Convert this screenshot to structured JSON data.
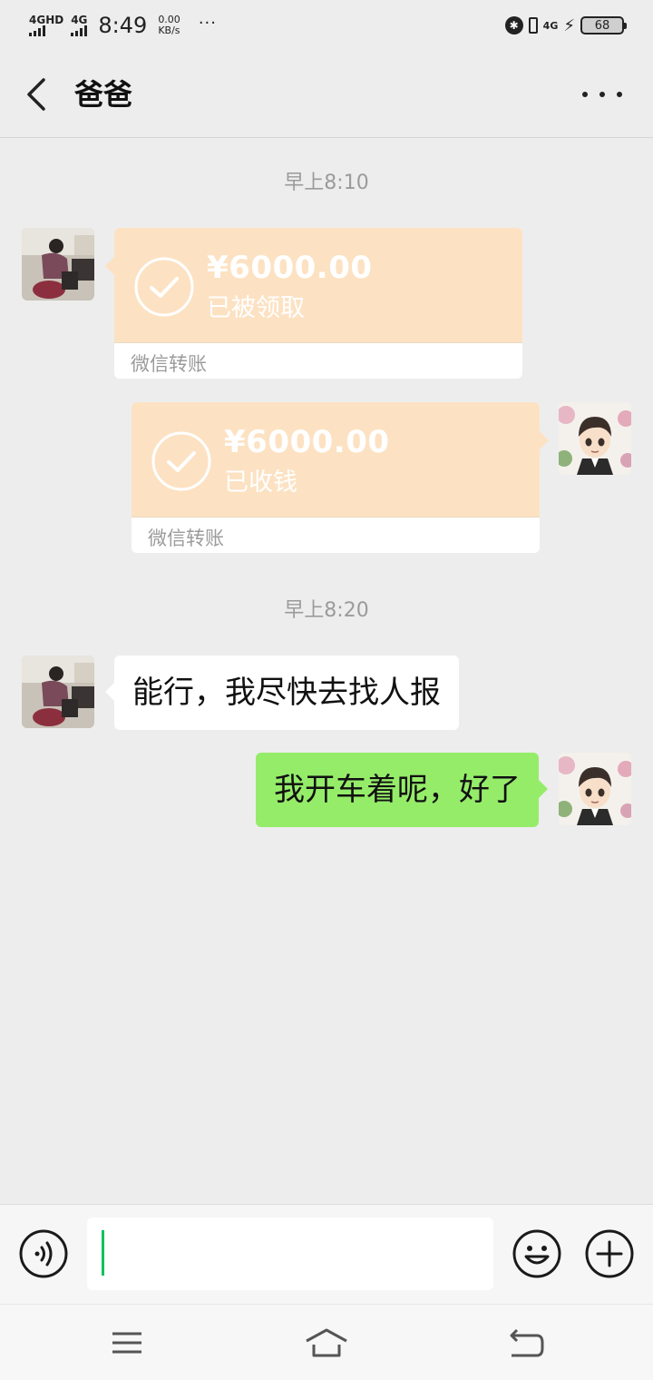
{
  "status_bar": {
    "network1": "4GHD",
    "network2": "4G",
    "time": "8:49",
    "speed_value": "0.00",
    "speed_unit": "KB/s",
    "dots": "···",
    "mobile_data": "4G",
    "battery": "68"
  },
  "header": {
    "title": "爸爸"
  },
  "messages": [
    {
      "type": "timestamp",
      "text": "早上8:10"
    },
    {
      "type": "transfer",
      "side": "in",
      "amount": "¥6000.00",
      "status": "已被领取",
      "label": "微信转账"
    },
    {
      "type": "transfer",
      "side": "out",
      "amount": "¥6000.00",
      "status": "已收钱",
      "label": "微信转账"
    },
    {
      "type": "timestamp",
      "text": "早上8:20"
    },
    {
      "type": "text",
      "side": "in",
      "text": "能行，我尽快去找人报"
    },
    {
      "type": "text",
      "side": "out",
      "text": "我开车着呢，好了"
    }
  ],
  "input": {
    "value": ""
  },
  "colors": {
    "background": "#ededed",
    "transfer_card": "#fce2c3",
    "outgoing_bubble": "#95ec69",
    "caret": "#07c160"
  },
  "icons": {
    "back": "chevron-left-icon",
    "more": "more-dots-icon",
    "voice": "voice-icon",
    "emoji": "emoji-icon",
    "plus": "plus-icon",
    "nav_menu": "menu-icon",
    "nav_home": "home-icon",
    "nav_back": "back-arrow-icon"
  }
}
